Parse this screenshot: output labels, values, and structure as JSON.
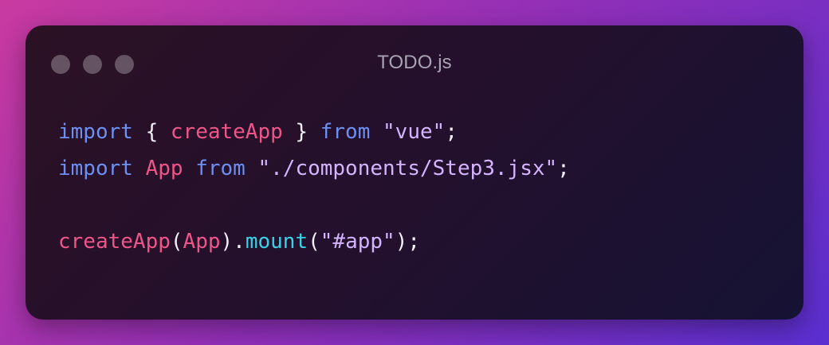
{
  "window": {
    "title": "TODO.js",
    "controls": [
      "close-dot",
      "minimize-dot",
      "maximize-dot"
    ]
  },
  "code": {
    "line1": {
      "kw1": "import",
      "p1": " { ",
      "id1": "createApp",
      "p2": " } ",
      "kw2": "from",
      "p3": " ",
      "str1": "\"vue\"",
      "p4": ";"
    },
    "line2": {
      "kw1": "import",
      "p1": " ",
      "id1": "App",
      "p2": " ",
      "kw2": "from",
      "p3": " ",
      "str1": "\"./components/Step3.jsx\"",
      "p4": ";"
    },
    "line4": {
      "id1": "createApp",
      "p1": "(",
      "id2": "App",
      "p2": ").",
      "fn1": "mount",
      "p3": "(",
      "str1": "\"#app\"",
      "p4": ");"
    }
  },
  "colors": {
    "keyword": "#6b8ff2",
    "identifier": "#f0558a",
    "string": "#d4b3ff",
    "function": "#39d3e8",
    "punctuation": "#f1eef6"
  }
}
